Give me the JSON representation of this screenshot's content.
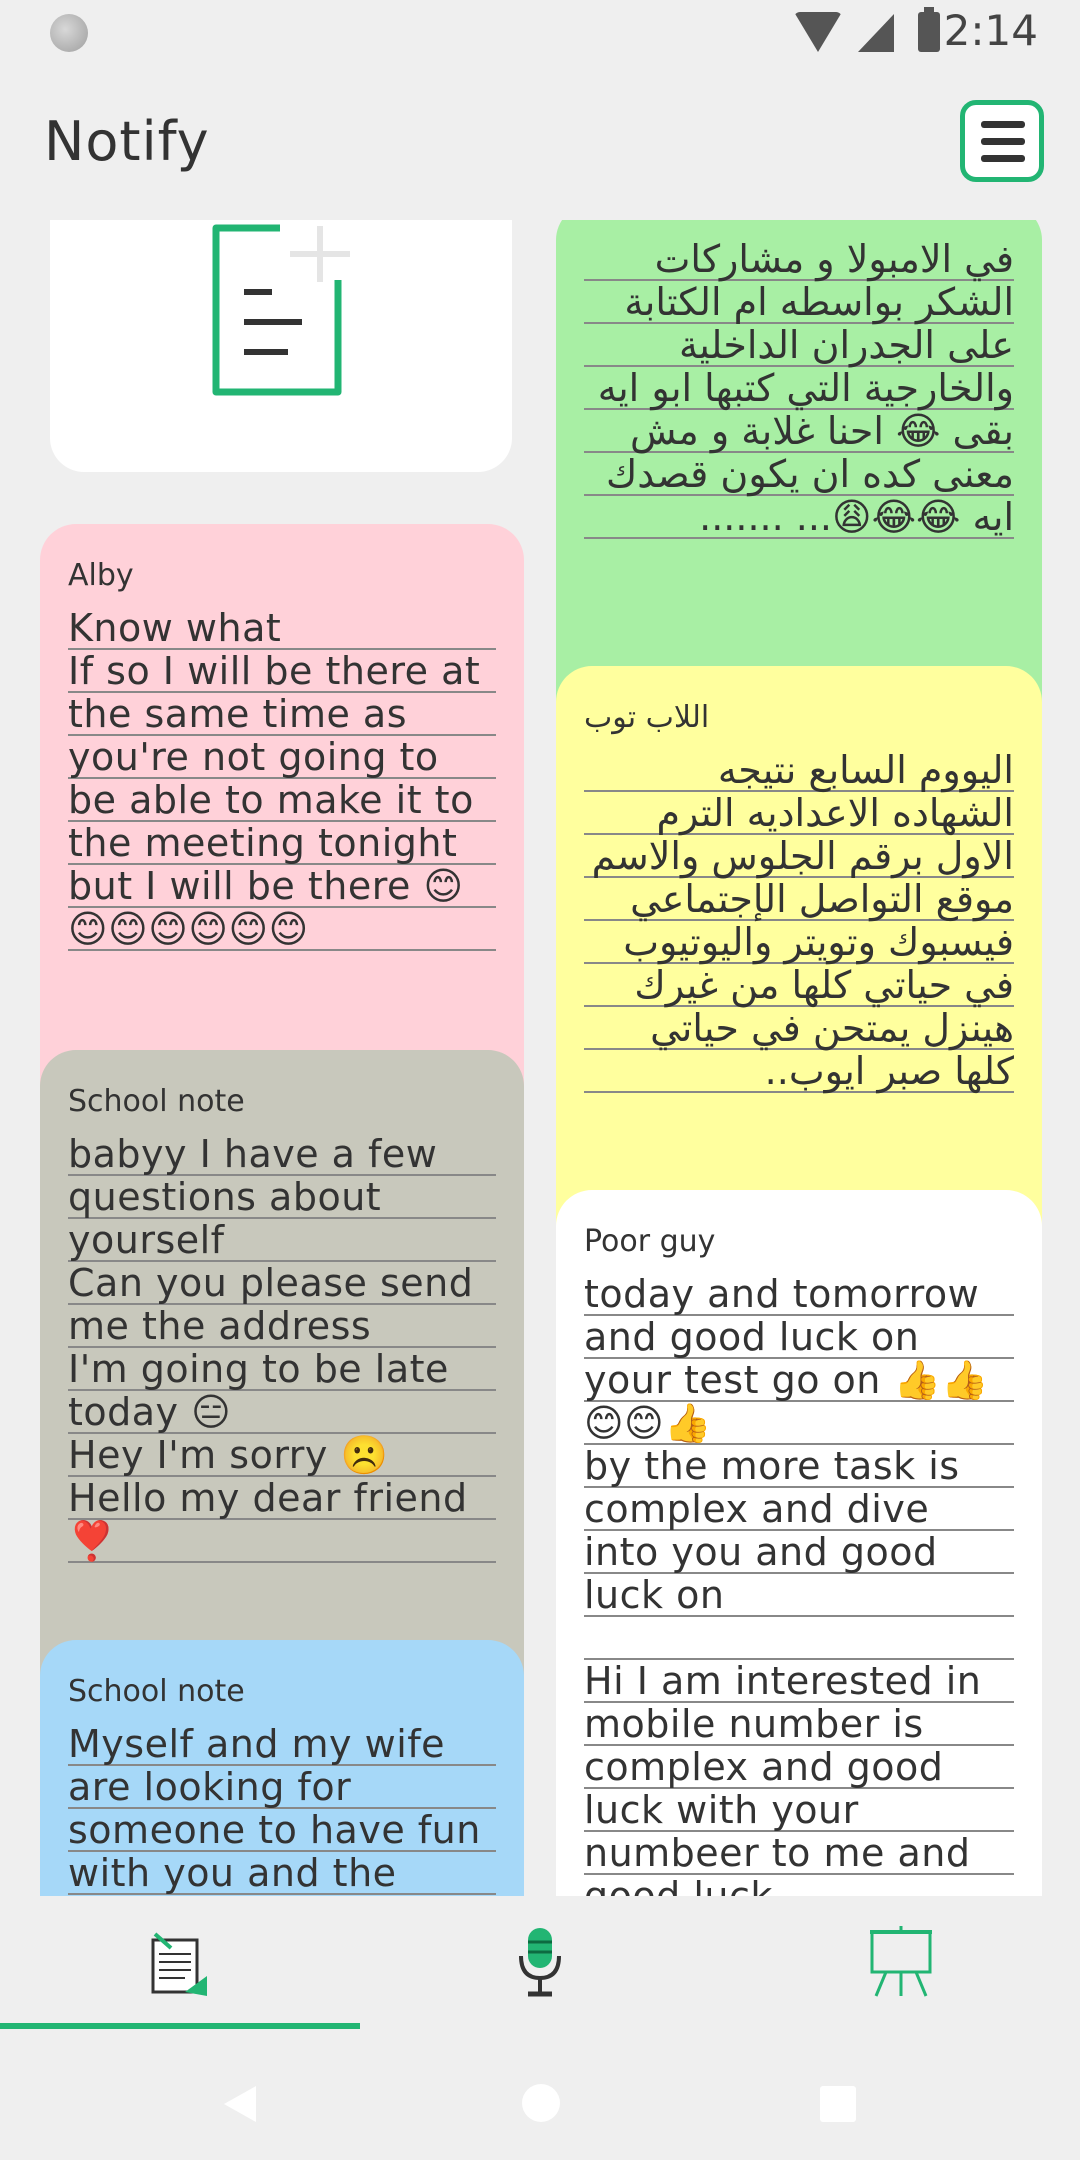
{
  "status_bar": {
    "time": "2:14"
  },
  "app": {
    "title": "Notify"
  },
  "notes": [
    {
      "title": "",
      "color": "#a8efa4",
      "body": "في الامبولا و مشاركات الشكر بواسطه ام الكتابة على الجدران الداخلية والخارجية التي كتبها ابو ايه بقى 😂 احنا غلابة و مش معنى كده ان يكون قصدك ايه 😂😂😩... ......."
    },
    {
      "title": "Alby",
      "color": "#ffd1d9",
      "body": "Know what\nIf so I will be there at the same time as you're not going to be able to make it to the meeting tonight but I will be there 😊 😊😊😊😊😊😊"
    },
    {
      "title": "اللاب توب",
      "color": "#ffff9e",
      "body": "اليووم السابع نتيجه الشهاده الاعداديه الترم الاول برقم الجلوس والاسم موقع التواصل الإجتماعي فيسبوك وتويتر واليوتيوب في حياتي كلها من غيرك هينزل يمتحن في حياتي كلها صبر ايوب.."
    },
    {
      "title": "School note",
      "color": "#c8c8bc",
      "body": "babyy I have a few questions about yourself\nCan you please send me the address\nI'm going to be late today 😑\nHey I'm sorry ☹️\nHello my dear friend ❣️"
    },
    {
      "title": "Poor guy",
      "color": "#ffffff",
      "body": "today and tomorrow and good luck on your test go on 👍👍 😊😊👍\nby the more task is complex and dive into you and good luck on\n\nHi I am interested in mobile number is complex and good luck with your numbeer to me and good luck"
    },
    {
      "title": "School note",
      "color": "#a6d8f8",
      "body": "Myself and my wife are looking for someone to have fun with you and the"
    }
  ],
  "bottom_nav": [
    {
      "name": "notes",
      "icon": "notes-icon",
      "active": true
    },
    {
      "name": "voice",
      "icon": "microphone-icon",
      "active": false
    },
    {
      "name": "board",
      "icon": "easel-icon",
      "active": false
    }
  ],
  "accent_color": "#22b573"
}
